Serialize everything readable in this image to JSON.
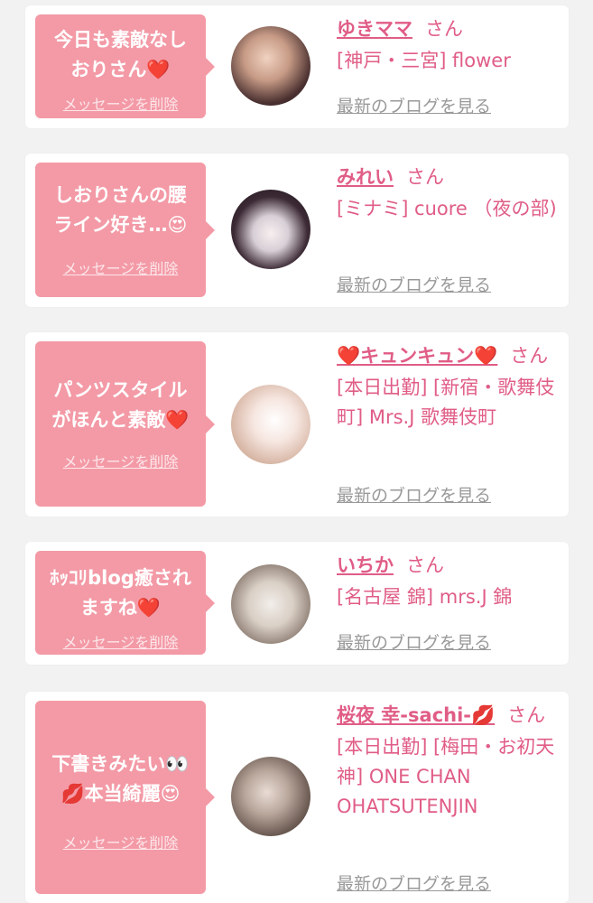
{
  "delete_label": "メッセージを削除",
  "blog_label": "最新のブログを見る",
  "san": "さん",
  "items": [
    {
      "message": "今日も素敵なしおりさん❤️",
      "name": "ゆきママ",
      "shop": "[神戸・三宮] flower"
    },
    {
      "message": "しおりさんの腰ライン好き…😍",
      "name": "みれい",
      "shop": "[ミナミ] cuore （夜の部)"
    },
    {
      "message": "パンツスタイルがほんと素敵❤️",
      "name": "❤️キュンキュン❤️",
      "shop": "[本日出勤] [新宿・歌舞伎町] Mrs.J 歌舞伎町"
    },
    {
      "message": "ﾎｯｺﾘblog癒されますね❤️",
      "name": "いちか",
      "shop": "[名古屋 錦] mrs.J 錦"
    },
    {
      "message": "下書きみたい👀💋本当綺麗😍",
      "name": "桜夜 幸-sachi-💋",
      "shop": "[本日出勤] [梅田・お初天神] ONE CHAN OHATSUTENJIN"
    }
  ],
  "colors": {
    "bubble": "#f39aa6",
    "accent": "#e05d86",
    "muted": "#999999"
  }
}
